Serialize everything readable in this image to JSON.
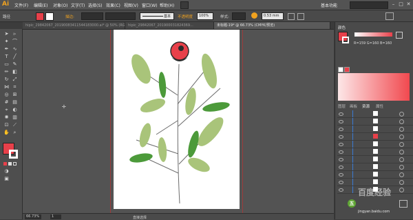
{
  "app": {
    "logo": "Ai",
    "workspace": "基本功能"
  },
  "menu": [
    "文件(F)",
    "编辑(E)",
    "对象(O)",
    "文字(T)",
    "选择(S)",
    "效果(C)",
    "视图(V)",
    "窗口(W)",
    "帮助(H)"
  ],
  "controlbar": {
    "selection_label": "路径",
    "stroke_label": "描边:",
    "brush_label": "基本",
    "opacity_label": "不透明度",
    "opacity_value": "100%",
    "style_label": "样式:",
    "width_value": "0.53 mm"
  },
  "tabs": [
    {
      "label": "hipic_29842067_20190083411544183000.ai* @ 50% (RGB/预览)",
      "active": false
    },
    {
      "label": "hipic_29842067_201900031824369...",
      "active": false
    },
    {
      "label": "未标题-19* @ 66.73% (CMYK/预览)",
      "active": true
    }
  ],
  "status": {
    "zoom": "66.73%",
    "page": "1",
    "tool": "直接选择"
  },
  "color_panel": {
    "tab": "颜色",
    "values": "R=159 G=160 B=160",
    "fill_color": "#e8404a"
  },
  "layers_panel": {
    "tabs": [
      "图层",
      "画板",
      "资源",
      "属性"
    ],
    "row_count": 11
  },
  "illustration": {
    "leaf_color_light": "#a9c47a",
    "leaf_color_dark": "#4c9a3a",
    "berry_color": "#e8404a",
    "stem_color": "#6a6a6a"
  },
  "watermark": {
    "text": "百度经验",
    "circle": "五",
    "url": "jingyan.baidu.com"
  }
}
